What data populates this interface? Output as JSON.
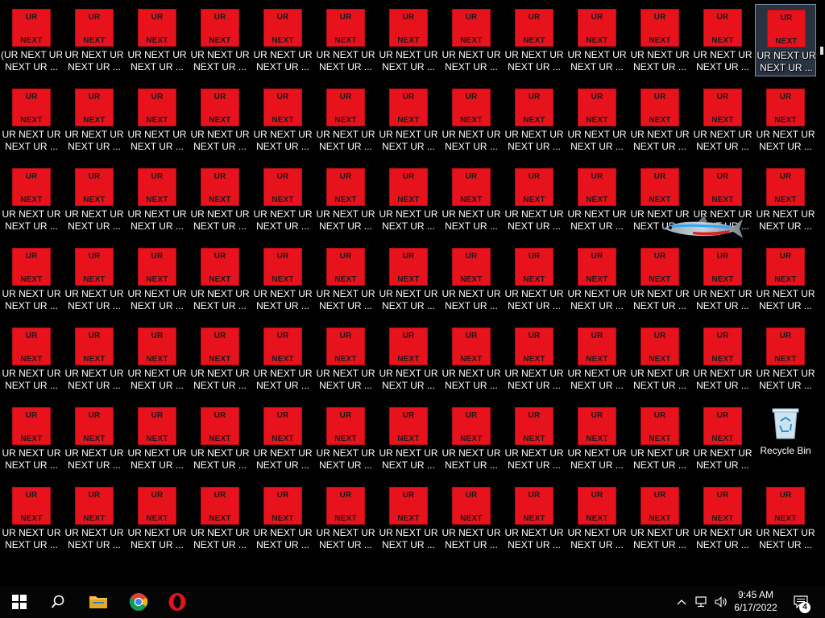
{
  "desktop": {
    "icon_tile_top": "UR",
    "icon_tile_bottom": "NEXT",
    "icon_label_line1": "UR NEXT UR",
    "icon_label_line2": "NEXT UR ...",
    "first_icon_label_line1": "(UR NEXT UR.",
    "rows": 7,
    "columns": 13,
    "selected_icon": {
      "row": 0,
      "col": 12
    },
    "tile_color": "#e8121c",
    "recycle_bin": {
      "label": "Recycle Bin",
      "row": 5,
      "col": 12,
      "icon": "recycle-bin-icon"
    },
    "wallpaper_object": "neon-tetra-fish"
  },
  "taskbar": {
    "apps": [
      {
        "name": "start-button",
        "icon": "windows-logo-icon"
      },
      {
        "name": "search-button",
        "icon": "search-icon"
      },
      {
        "name": "file-explorer-button",
        "icon": "folder-icon"
      },
      {
        "name": "chrome-button",
        "icon": "chrome-icon"
      },
      {
        "name": "opera-button",
        "icon": "opera-icon"
      }
    ],
    "tray": {
      "chevron": "chevron-up-icon",
      "network": "network-icon",
      "volume": "volume-icon",
      "time": "9:45 AM",
      "date": "6/17/2022",
      "notification_count": "4"
    }
  }
}
